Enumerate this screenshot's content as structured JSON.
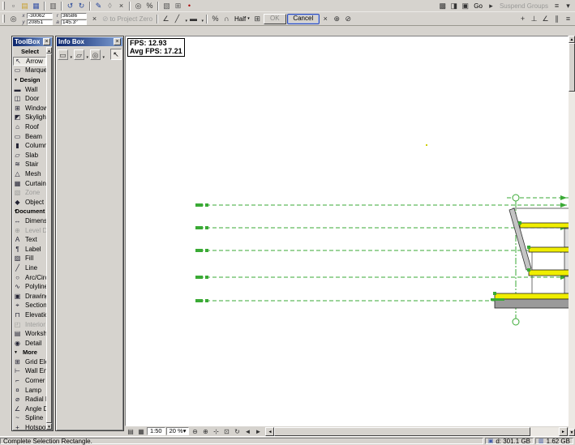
{
  "colors": {
    "palette_title": "#0a246a",
    "drawing_green": "#3aaa35",
    "slab_yellow": "#f0ee00",
    "cancel_border": "#2a49b8"
  },
  "ui": {
    "close": "×",
    "dropdown": "▾",
    "collapse": "▼",
    "scroll_up": "▲",
    "scroll_down": "▼",
    "scroll_left": "◄",
    "scroll_right": "►"
  },
  "topbar": {
    "row1_left": [
      {
        "n": "new-document-icon",
        "g": "▫",
        "c": "#555"
      },
      {
        "n": "open-icon",
        "g": "▤",
        "c": "#c8a030"
      },
      {
        "n": "save-icon",
        "g": "▦",
        "c": "#3a56a8"
      },
      {
        "sep": true
      },
      {
        "n": "print-icon",
        "g": "▥",
        "c": "#555"
      },
      {
        "sep": true
      },
      {
        "n": "undo-icon",
        "g": "↺",
        "c": "#2a4a9a"
      },
      {
        "n": "redo-icon",
        "g": "↻",
        "c": "#2a4a9a"
      },
      {
        "sep": true
      },
      {
        "n": "pen-tool-icon",
        "g": "✎",
        "c": "#20409a"
      },
      {
        "n": "eraser-icon",
        "g": "◊",
        "c": "#888"
      },
      {
        "n": "delete-icon",
        "g": "×",
        "c": "#333"
      },
      {
        "sep": true
      },
      {
        "n": "find-select-icon",
        "g": "◎",
        "c": "#333"
      },
      {
        "n": "zoom-percent-icon",
        "g": "%",
        "c": "#333"
      },
      {
        "sep": true
      },
      {
        "n": "layers-icon",
        "g": "▧",
        "c": "#555"
      },
      {
        "n": "grid-icon",
        "g": "⊞",
        "c": "#555"
      },
      {
        "n": "marker-icon",
        "g": "•",
        "c": "#a00"
      }
    ],
    "row1_right_pre": [
      {
        "n": "teamwork-icon",
        "g": "▩"
      },
      {
        "n": "publish-icon",
        "g": "◨"
      },
      {
        "n": "library-icon",
        "g": "▣"
      }
    ],
    "go": "Go",
    "row1_right_mid": [
      {
        "n": "go-arrow-icon",
        "g": "▸"
      }
    ],
    "suspend_groups": "Suspend Groups",
    "row1_right_post": [
      {
        "n": "groups-icon",
        "g": "≡"
      },
      {
        "n": "more-options-icon",
        "g": "▾"
      }
    ],
    "coord_labels": {
      "x": "x",
      "y": "y",
      "r": "r",
      "a": "a"
    },
    "coord_x": "-30062",
    "coord_y": "20851",
    "coord_r": "36586",
    "coord_a": "145.3°",
    "row2_left_icon": {
      "n": "tracker-icon",
      "g": "◎"
    },
    "project_zero_icon": "⊘",
    "project_zero": "to Project Zero",
    "row2_mid": [
      {
        "n": "relative-coords-icon",
        "g": "∠"
      },
      {
        "n": "line-type-icon",
        "g": "╱",
        "dd": true
      },
      {
        "n": "pen-weight-icon",
        "g": "▬",
        "dd": true
      },
      {
        "sep": true
      },
      {
        "n": "percent-icon",
        "g": "%"
      },
      {
        "n": "snap-icon",
        "g": "∩"
      }
    ],
    "half": "Half",
    "row2_after_half": [
      {
        "n": "snap-grid-icon",
        "g": "⊞"
      }
    ],
    "ok": "OK",
    "cancel": "Cancel",
    "row2_after_cancel": [
      {
        "n": "close-x-icon",
        "g": "×"
      },
      {
        "n": "origin-icon",
        "g": "⊕"
      },
      {
        "n": "no-entry-icon",
        "g": "⊘"
      }
    ],
    "row2_right": [
      {
        "n": "add-icon",
        "g": "+"
      },
      {
        "n": "perpendicular-icon",
        "g": "⊥"
      },
      {
        "n": "angle-icon",
        "g": "∠"
      },
      {
        "n": "parallel-icon",
        "g": "∥"
      },
      {
        "n": "list-icon",
        "g": "≡"
      }
    ]
  },
  "toolbox": {
    "title": "ToolBox",
    "groups": [
      {
        "label": "Select",
        "arrow": false,
        "items": [
          {
            "label": "Arrow",
            "icon": "↖",
            "selected": true
          },
          {
            "label": "Marquee",
            "icon": "▭"
          }
        ]
      },
      {
        "label": "Design",
        "arrow": true,
        "items": [
          {
            "label": "Wall",
            "icon": "▬"
          },
          {
            "label": "Door",
            "icon": "◫"
          },
          {
            "label": "Window",
            "icon": "⊞"
          },
          {
            "label": "Skylight",
            "icon": "◩"
          },
          {
            "label": "Roof",
            "icon": "⌂"
          },
          {
            "label": "Beam",
            "icon": "▭"
          },
          {
            "label": "Column",
            "icon": "▮"
          },
          {
            "label": "Slab",
            "icon": "▱"
          },
          {
            "label": "Stair",
            "icon": "≋"
          },
          {
            "label": "Mesh",
            "icon": "△"
          },
          {
            "label": "Curtain Wall",
            "icon": "▦"
          },
          {
            "label": "Zone",
            "icon": "▧",
            "disabled": true
          },
          {
            "label": "Object",
            "icon": "◆"
          }
        ]
      },
      {
        "label": "Document",
        "arrow": true,
        "items": [
          {
            "label": "Dimension",
            "icon": "↔"
          },
          {
            "label": "Level Dim...",
            "icon": "⊕",
            "disabled": true
          },
          {
            "label": "Text",
            "icon": "A"
          },
          {
            "label": "Label",
            "icon": "¶"
          },
          {
            "label": "Fill",
            "icon": "▨"
          },
          {
            "label": "Line",
            "icon": "╱"
          },
          {
            "label": "Arc/Circle",
            "icon": "○"
          },
          {
            "label": "Polyline",
            "icon": "∿"
          },
          {
            "label": "Drawing",
            "icon": "▣"
          },
          {
            "label": "Section",
            "icon": "⌖"
          },
          {
            "label": "Elevation",
            "icon": "⊓"
          },
          {
            "label": "Interior Ele...",
            "icon": "◰",
            "disabled": true
          },
          {
            "label": "Worksheet",
            "icon": "▤"
          },
          {
            "label": "Detail",
            "icon": "◉"
          }
        ]
      },
      {
        "label": "More",
        "arrow": true,
        "items": [
          {
            "label": "Grid Elem...",
            "icon": "⊞"
          },
          {
            "label": "Wall End",
            "icon": "⊢"
          },
          {
            "label": "Corner W...",
            "icon": "⌐"
          },
          {
            "label": "Lamp",
            "icon": "¤"
          },
          {
            "label": "Radial Di...",
            "icon": "⌀"
          },
          {
            "label": "Angle Di...",
            "icon": "∠"
          },
          {
            "label": "Spline",
            "icon": "~"
          },
          {
            "label": "Hotspot",
            "icon": "+"
          }
        ]
      }
    ]
  },
  "infobox": {
    "title": "Info Box",
    "tools": [
      {
        "n": "marquee-shape-icon",
        "g": "▭",
        "dd": true
      },
      {
        "n": "rotated-marquee-icon",
        "g": "▱",
        "dd": true
      },
      {
        "n": "selection-method-icon",
        "g": "◎",
        "dd": true
      }
    ],
    "arrow_icon": {
      "n": "arrow-cursor-icon",
      "g": "↖"
    }
  },
  "canvas": {
    "fps1": "FPS: 12.93",
    "fps2": "Avg FPS: 17.21"
  },
  "bottombar": {
    "pre_icons": [
      {
        "n": "quick-options-icon",
        "g": "▤"
      },
      {
        "n": "pen-set-icon",
        "g": "▦"
      }
    ],
    "scale": "1:50",
    "zoom": "20 %",
    "zoom_icons": [
      {
        "n": "zoom-out-icon",
        "g": "⊖"
      },
      {
        "n": "zoom-in-icon",
        "g": "⊕"
      },
      {
        "n": "pan-icon",
        "g": "⊹"
      },
      {
        "n": "fit-in-window-icon",
        "g": "⊡"
      },
      {
        "n": "orbit-icon",
        "g": "↻"
      },
      {
        "n": "previous-view-icon",
        "g": "◄"
      },
      {
        "n": "next-view-icon",
        "g": "►"
      }
    ]
  },
  "statusbar": {
    "message": "Complete Selection Rectangle.",
    "disk_icon": "▣",
    "disk": "d: 301.1 GB",
    "mem_icon": "▥",
    "memory": "1.62 GB"
  }
}
